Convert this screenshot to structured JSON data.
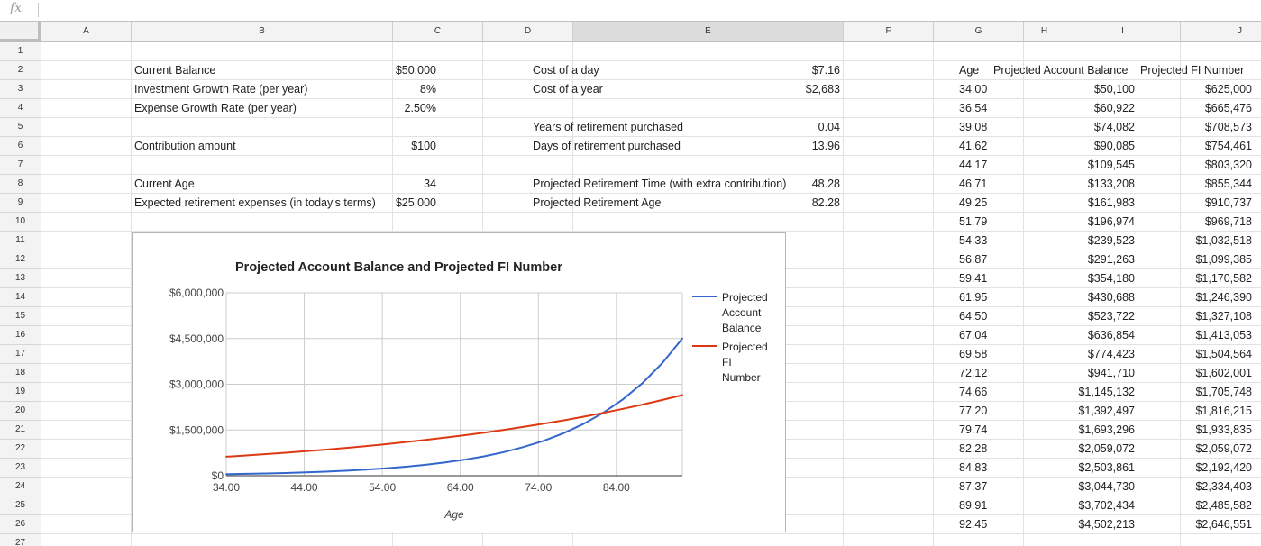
{
  "formula_bar": {
    "icon": "fx",
    "value": ""
  },
  "columns": [
    "A",
    "B",
    "C",
    "D",
    "E",
    "F",
    "G",
    "H",
    "I",
    "J"
  ],
  "rows": [
    "1",
    "2",
    "3",
    "4",
    "5",
    "6",
    "7",
    "8",
    "9",
    "10",
    "11",
    "12",
    "13",
    "14",
    "15",
    "16",
    "17",
    "18",
    "19",
    "20",
    "21",
    "22",
    "23",
    "24",
    "25",
    "26",
    "27"
  ],
  "inputs": {
    "current_balance": {
      "label": "Current Balance",
      "value": "$50,000"
    },
    "growth_rate": {
      "label": "Investment Growth Rate (per year)",
      "value": "8%"
    },
    "expense_growth": {
      "label": "Expense Growth Rate (per year)",
      "value": "2.50%"
    },
    "contribution": {
      "label": "Contribution amount",
      "value": "$100"
    },
    "current_age": {
      "label": "Current Age",
      "value": "34"
    },
    "retirement_expenses": {
      "label": "Expected retirement expenses (in today's terms)",
      "value": "$25,000"
    }
  },
  "outputs": {
    "cost_day": {
      "label": "Cost of a day",
      "value": "$7.16"
    },
    "cost_year": {
      "label": "Cost of a year",
      "value": "$2,683"
    },
    "years_purchased": {
      "label": "Years of retirement purchased",
      "value": "0.04"
    },
    "days_purchased": {
      "label": "Days of retirement purchased",
      "value": "13.96"
    },
    "retirement_time": {
      "label": "Projected Retirement Time (with extra contribution)",
      "value": "48.28"
    },
    "retirement_age": {
      "label": "Projected Retirement Age",
      "value": "82.28"
    }
  },
  "table": {
    "headers": [
      "Age",
      "Projected Account Balance",
      "Projected FI Number"
    ],
    "rows": [
      [
        "34.00",
        "$50,100",
        "$625,000"
      ],
      [
        "36.54",
        "$60,922",
        "$665,476"
      ],
      [
        "39.08",
        "$74,082",
        "$708,573"
      ],
      [
        "41.62",
        "$90,085",
        "$754,461"
      ],
      [
        "44.17",
        "$109,545",
        "$803,320"
      ],
      [
        "46.71",
        "$133,208",
        "$855,344"
      ],
      [
        "49.25",
        "$161,983",
        "$910,737"
      ],
      [
        "51.79",
        "$196,974",
        "$969,718"
      ],
      [
        "54.33",
        "$239,523",
        "$1,032,518"
      ],
      [
        "56.87",
        "$291,263",
        "$1,099,385"
      ],
      [
        "59.41",
        "$354,180",
        "$1,170,582"
      ],
      [
        "61.95",
        "$430,688",
        "$1,246,390"
      ],
      [
        "64.50",
        "$523,722",
        "$1,327,108"
      ],
      [
        "67.04",
        "$636,854",
        "$1,413,053"
      ],
      [
        "69.58",
        "$774,423",
        "$1,504,564"
      ],
      [
        "72.12",
        "$941,710",
        "$1,602,001"
      ],
      [
        "74.66",
        "$1,145,132",
        "$1,705,748"
      ],
      [
        "77.20",
        "$1,392,497",
        "$1,816,215"
      ],
      [
        "79.74",
        "$1,693,296",
        "$1,933,835"
      ],
      [
        "82.28",
        "$2,059,072",
        "$2,059,072"
      ],
      [
        "84.83",
        "$2,503,861",
        "$2,192,420"
      ],
      [
        "87.37",
        "$3,044,730",
        "$2,334,403"
      ],
      [
        "89.91",
        "$3,702,434",
        "$2,485,582"
      ],
      [
        "92.45",
        "$4,502,213",
        "$2,646,551"
      ]
    ]
  },
  "chart_data": {
    "type": "line",
    "title": "Projected Account Balance and Projected FI Number",
    "xlabel": "Age",
    "ylabel": "",
    "x": [
      34.0,
      36.54,
      39.08,
      41.62,
      44.17,
      46.71,
      49.25,
      51.79,
      54.33,
      56.87,
      59.41,
      61.95,
      64.5,
      67.04,
      69.58,
      72.12,
      74.66,
      77.2,
      79.74,
      82.28,
      84.83,
      87.37,
      89.91,
      92.45
    ],
    "series": [
      {
        "name": "Projected Account Balance",
        "color": "#3366cc",
        "values": [
          50100,
          60922,
          74082,
          90085,
          109545,
          133208,
          161983,
          196974,
          239523,
          291263,
          354180,
          430688,
          523722,
          636854,
          774423,
          941710,
          1145132,
          1392497,
          1693296,
          2059072,
          2503861,
          3044730,
          3702434,
          4502213
        ]
      },
      {
        "name": "Projected FI Number",
        "color": "#dc3912",
        "values": [
          625000,
          665476,
          708573,
          754461,
          803320,
          855344,
          910737,
          969718,
          1032518,
          1099385,
          1170582,
          1246390,
          1327108,
          1413053,
          1504564,
          1602001,
          1705748,
          1816215,
          1933835,
          2059072,
          2192420,
          2334403,
          2485582,
          2646551
        ]
      }
    ],
    "x_ticks": [
      34,
      44,
      54,
      64,
      74,
      84
    ],
    "x_tick_labels": [
      "34.00",
      "44.00",
      "54.00",
      "64.00",
      "74.00",
      "84.00"
    ],
    "y_ticks": [
      0,
      1500000,
      3000000,
      4500000,
      6000000
    ],
    "y_tick_labels": [
      "$0",
      "$1,500,000",
      "$3,000,000",
      "$4,500,000",
      "$6,000,000"
    ],
    "xlim": [
      34,
      92.45
    ],
    "ylim": [
      0,
      6000000
    ],
    "grid": true,
    "legend_position": "right",
    "legend_lines": [
      [
        "Projected",
        "Account",
        "Balance"
      ],
      [
        "Projected",
        "FI",
        "Number"
      ]
    ]
  }
}
